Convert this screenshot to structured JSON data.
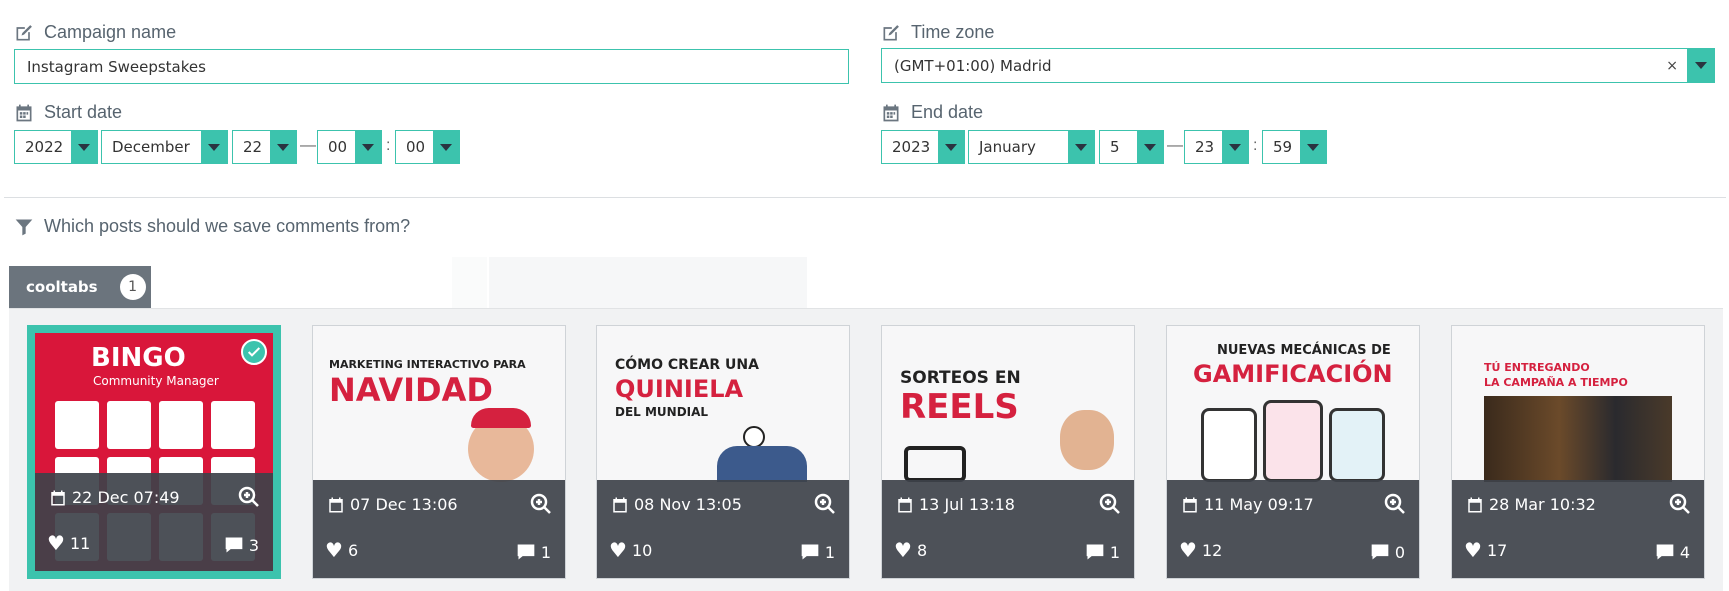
{
  "form": {
    "campaign_name": {
      "label": "Campaign name",
      "value": "Instagram Sweepstakes"
    },
    "time_zone": {
      "label": "Time zone",
      "value": "(GMT+01:00) Madrid",
      "clear": "×"
    },
    "start_date": {
      "label": "Start date",
      "year": "2022",
      "month": "December",
      "day": "22",
      "hour": "00",
      "minute": "00"
    },
    "end_date": {
      "label": "End date",
      "year": "2023",
      "month": "January",
      "day": "5",
      "hour": "23",
      "minute": "59"
    },
    "dash": "—",
    "colon": ":"
  },
  "posts_section": {
    "title": "Which posts should we save comments from?"
  },
  "tabs": [
    {
      "label": "cooltabs",
      "count": "1"
    }
  ],
  "posts": [
    {
      "date": "22 Dec 07:49",
      "likes": "11",
      "comments": "3",
      "selected": true,
      "thumb": {
        "title": "BINGO",
        "subtitle": "Community Manager"
      }
    },
    {
      "date": "07 Dec 13:06",
      "likes": "6",
      "comments": "1",
      "thumb": {
        "line1": "MARKETING INTERACTIVO PARA",
        "line2": "NAVIDAD"
      }
    },
    {
      "date": "08 Nov 13:05",
      "likes": "10",
      "comments": "1",
      "thumb": {
        "line1": "CÓMO CREAR UNA",
        "line2": "QUINIELA",
        "line3": "DEL MUNDIAL"
      }
    },
    {
      "date": "13 Jul 13:18",
      "likes": "8",
      "comments": "1",
      "thumb": {
        "line1": "SORTEOS EN",
        "line2": "REELS"
      }
    },
    {
      "date": "11 May 09:17",
      "likes": "12",
      "comments": "0",
      "thumb": {
        "line1": "NUEVAS MECÁNICAS DE",
        "line2": "GAMIFICACIÓN"
      }
    },
    {
      "date": "28 Mar 10:32",
      "likes": "17",
      "comments": "4",
      "thumb": {
        "line1": "TÚ ENTREGANDO",
        "line2": "LA CAMPAÑA A TIEMPO"
      }
    }
  ],
  "colors": {
    "accent": "#3cc3ad",
    "overlay": "#3e424a",
    "brand_red": "#d5213f"
  }
}
